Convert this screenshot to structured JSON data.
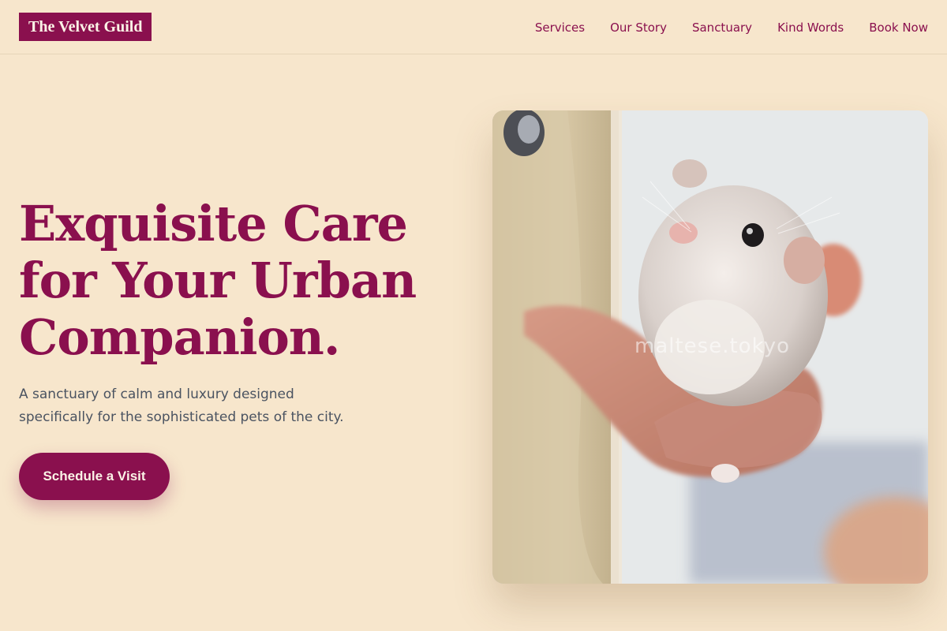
{
  "header": {
    "brand": "The Velvet Guild",
    "nav": [
      {
        "label": "Services"
      },
      {
        "label": "Our Story"
      },
      {
        "label": "Sanctuary"
      },
      {
        "label": "Kind Words"
      },
      {
        "label": "Book Now"
      }
    ]
  },
  "hero": {
    "title_lines": [
      "Exquisite Care",
      "for Your Urban",
      "Companion."
    ],
    "subtitle": "A sanctuary of calm and luxury designed specifically for the sophisticated pets of the city.",
    "cta_label": "Schedule a Visit",
    "image": {
      "subject": "hamster held in a hand",
      "watermark": "maltese.tokyo"
    }
  },
  "colors": {
    "background": "#f7e6cc",
    "accent": "#8a104e",
    "body_text": "#4a5361"
  }
}
